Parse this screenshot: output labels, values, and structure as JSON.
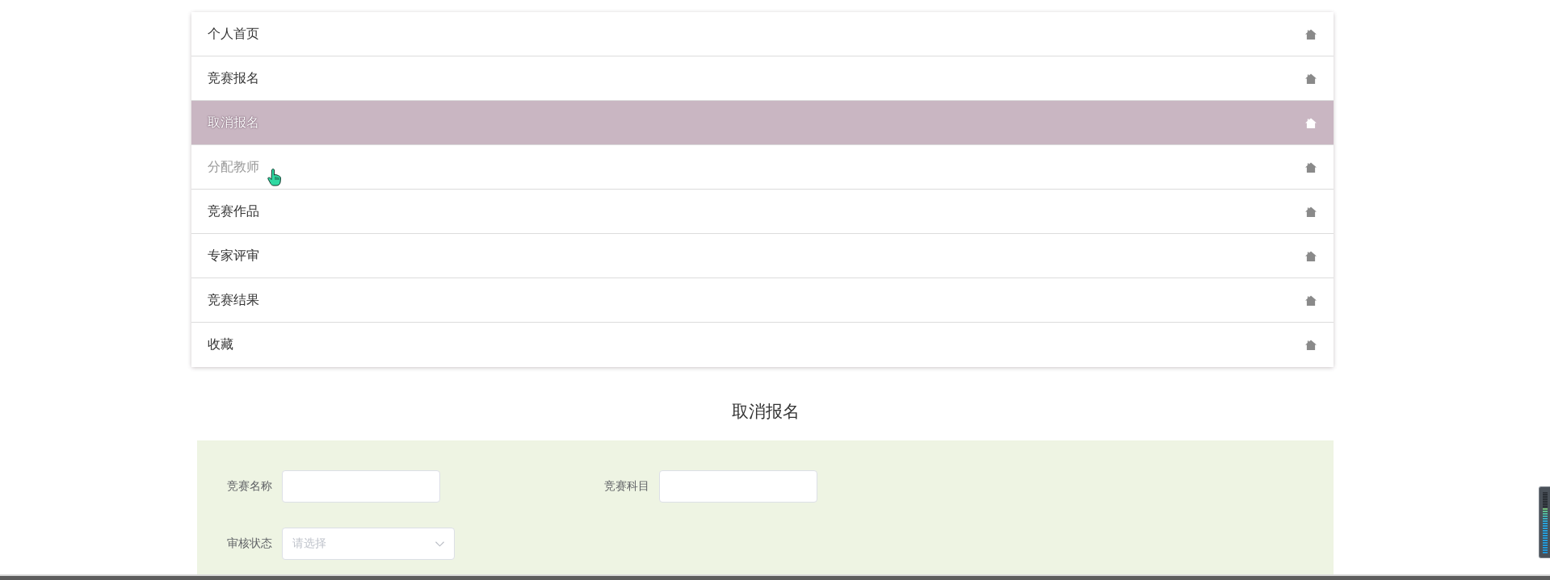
{
  "menu": {
    "items": [
      {
        "label": "个人首页",
        "selected": false,
        "hovered": false
      },
      {
        "label": "竞赛报名",
        "selected": false,
        "hovered": false
      },
      {
        "label": "取消报名",
        "selected": true,
        "hovered": false
      },
      {
        "label": "分配教师",
        "selected": false,
        "hovered": true
      },
      {
        "label": "竞赛作品",
        "selected": false,
        "hovered": false
      },
      {
        "label": "专家评审",
        "selected": false,
        "hovered": false
      },
      {
        "label": "竞赛结果",
        "selected": false,
        "hovered": false
      },
      {
        "label": "收藏",
        "selected": false,
        "hovered": false
      }
    ]
  },
  "page_title": "取消报名",
  "filter_form": {
    "fields": [
      {
        "kind": "text",
        "label": "竞赛名称"
      },
      {
        "kind": "text",
        "label": "竞赛科目"
      },
      {
        "kind": "select",
        "label": "审核状态",
        "placeholder": "请选择"
      }
    ]
  },
  "audio_meter": {
    "level": 0.75
  }
}
